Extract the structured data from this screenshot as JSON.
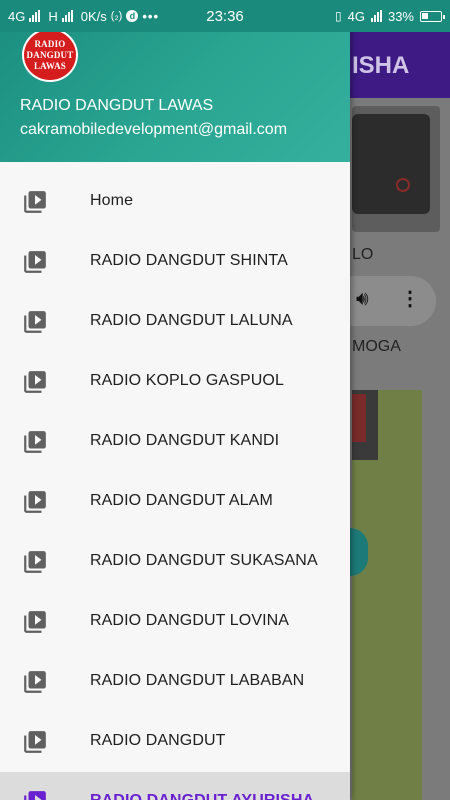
{
  "status_bar": {
    "network1": "4G",
    "network2": "H",
    "speed": "0K/s",
    "time": "23:36",
    "network3": "4G",
    "battery": "33%"
  },
  "background_app": {
    "title_fragment": "ISHA",
    "label1": "LO",
    "label2": "MOGA"
  },
  "drawer": {
    "logo_lines": [
      "RADIO",
      "DANGDUT",
      "LAWAS"
    ],
    "app_name": "RADIO DANGDUT LAWAS",
    "email": "cakramobiledevelopment@gmail.com",
    "items": [
      {
        "label": "Home",
        "icon": "playlist-play-icon"
      },
      {
        "label": "RADIO DANGDUT SHINTA",
        "icon": "playlist-play-icon"
      },
      {
        "label": "RADIO DANGDUT LALUNA",
        "icon": "playlist-play-icon"
      },
      {
        "label": "RADIO KOPLO GASPUOL",
        "icon": "playlist-play-icon"
      },
      {
        "label": "RADIO DANGDUT KANDI",
        "icon": "playlist-play-icon"
      },
      {
        "label": "RADIO DANGDUT ALAM",
        "icon": "playlist-play-icon"
      },
      {
        "label": "RADIO DANGDUT SUKASANA",
        "icon": "playlist-play-icon"
      },
      {
        "label": "RADIO DANGDUT LOVINA",
        "icon": "playlist-play-icon"
      },
      {
        "label": "RADIO DANGDUT LABABAN",
        "icon": "playlist-play-icon"
      },
      {
        "label": "RADIO DANGDUT",
        "icon": "playlist-play-icon"
      },
      {
        "label": "RADIO DANGDUT AYURISHA",
        "icon": "playlist-play-icon",
        "active": true
      }
    ]
  },
  "colors": {
    "header_start": "#1a8c7e",
    "header_end": "#35b09e",
    "active_text": "#6a1fd1",
    "icon_gray": "#606060",
    "icon_active": "#6a1fd1"
  }
}
